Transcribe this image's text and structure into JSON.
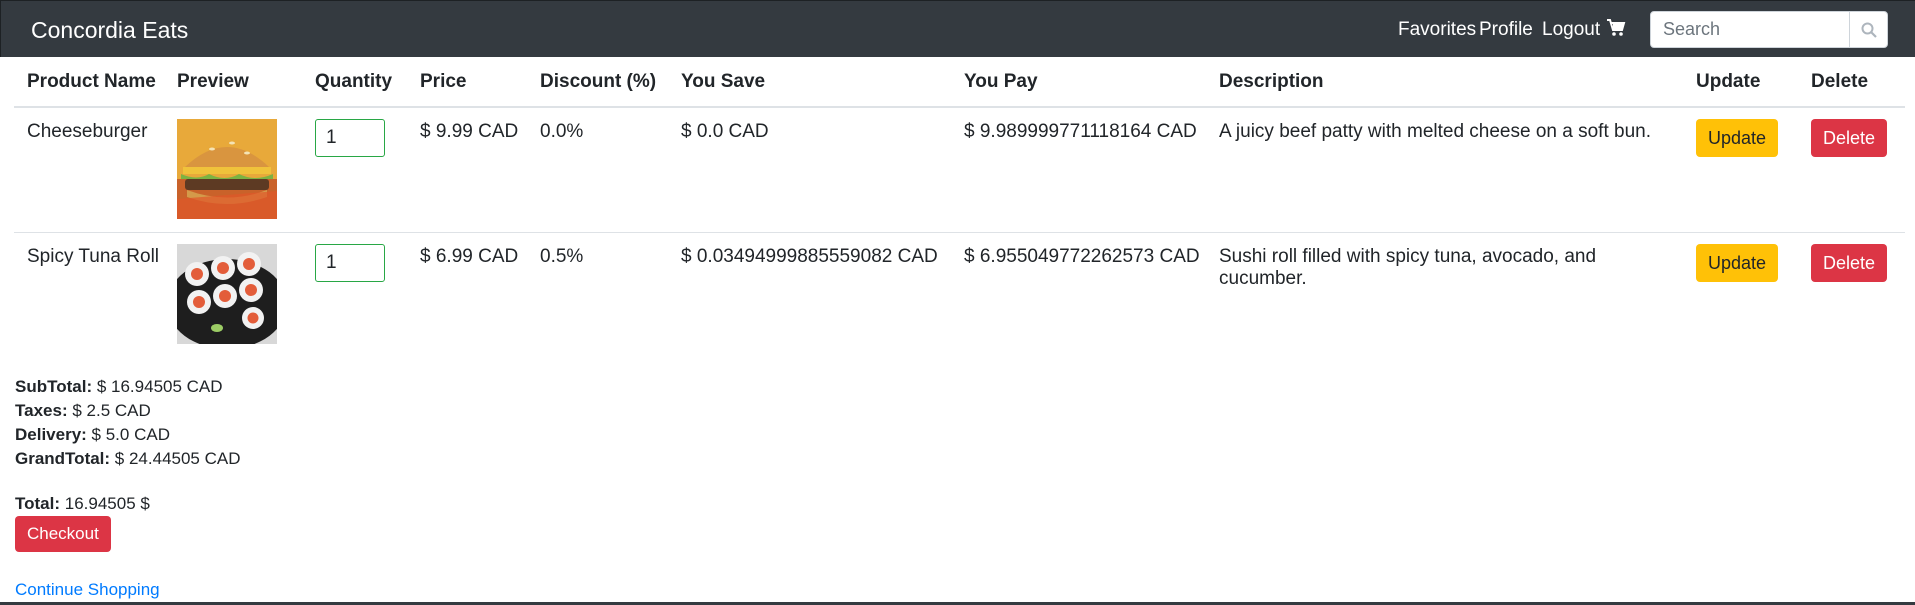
{
  "navbar": {
    "brand": "Concordia Eats",
    "links": [
      "Favorites",
      "Profile",
      "Logout"
    ],
    "cart_icon": "cart-icon",
    "search": {
      "placeholder": "Search",
      "value": "",
      "icon": "search-icon"
    }
  },
  "table": {
    "headers": [
      "Product Name",
      "Preview",
      "Quantity",
      "Price",
      "Discount (%)",
      "You Save",
      "You Pay",
      "Description",
      "Update",
      "Delete"
    ],
    "rows": [
      {
        "name": "Cheeseburger",
        "preview": "cheeseburger-image",
        "quantity": "1",
        "price": "$ 9.99 CAD",
        "discount": "0.0%",
        "you_save": "$ 0.0 CAD",
        "you_pay": "$ 9.989999771118164 CAD",
        "description": "A juicy beef patty with melted cheese on a soft bun.",
        "update_label": "Update",
        "delete_label": "Delete"
      },
      {
        "name": "Spicy Tuna Roll",
        "preview": "sushi-roll-image",
        "quantity": "1",
        "price": "$ 6.99 CAD",
        "discount": "0.5%",
        "you_save": "$ 0.03494999885559082 CAD",
        "you_pay": "$ 6.955049772262573 CAD",
        "description": "Sushi roll filled with spicy tuna, avocado, and cucumber.",
        "update_label": "Update",
        "delete_label": "Delete"
      }
    ]
  },
  "summary": {
    "subtotal_label": "SubTotal:",
    "subtotal_value": " $ 16.94505 CAD",
    "taxes_label": "Taxes:",
    "taxes_value": " $ 2.5 CAD",
    "delivery_label": "Delivery:",
    "delivery_value": " $ 5.0 CAD",
    "grandtotal_label": "GrandTotal:",
    "grandtotal_value": " $ 24.44505 CAD",
    "total_label": "Total:",
    "total_value": " 16.94505 $"
  },
  "actions": {
    "checkout_label": "Checkout",
    "continue_label": "Continue Shopping"
  },
  "colors": {
    "navbar": "#343a40",
    "warning": "#ffc107",
    "danger": "#dc3545",
    "link": "#007bff",
    "qty_border": "#28a745"
  }
}
